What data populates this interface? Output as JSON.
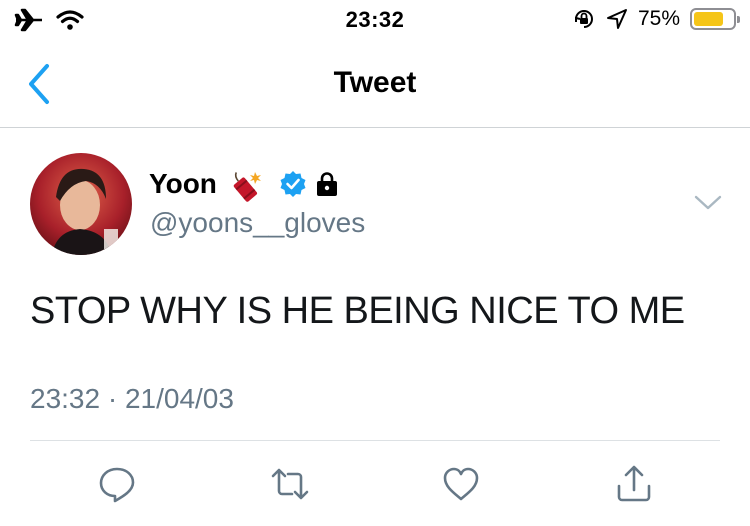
{
  "status_bar": {
    "time": "23:32",
    "battery_percent": "75%",
    "battery_level": 0.75,
    "battery_color": "#f5c518",
    "icons": [
      "airplane-icon",
      "wifi-icon",
      "orientation-lock-icon",
      "location-icon",
      "battery-icon"
    ]
  },
  "nav": {
    "title": "Tweet",
    "back_icon": "chevron-left-icon",
    "accent_color": "#1da1f2"
  },
  "tweet": {
    "author_name": "Yoon",
    "author_emoji": "firecracker-emoji",
    "verified": true,
    "protected": true,
    "handle": "@yoons__gloves",
    "text": "STOP WHY IS HE BEING NICE TO ME",
    "timestamp": "23:32 · 21/04/03"
  },
  "actions": [
    {
      "name": "reply-icon"
    },
    {
      "name": "retweet-icon"
    },
    {
      "name": "like-icon"
    },
    {
      "name": "share-icon"
    }
  ],
  "colors": {
    "secondary_text": "#657786",
    "icon_gray": "#657786",
    "verified_blue": "#1da1f2"
  }
}
